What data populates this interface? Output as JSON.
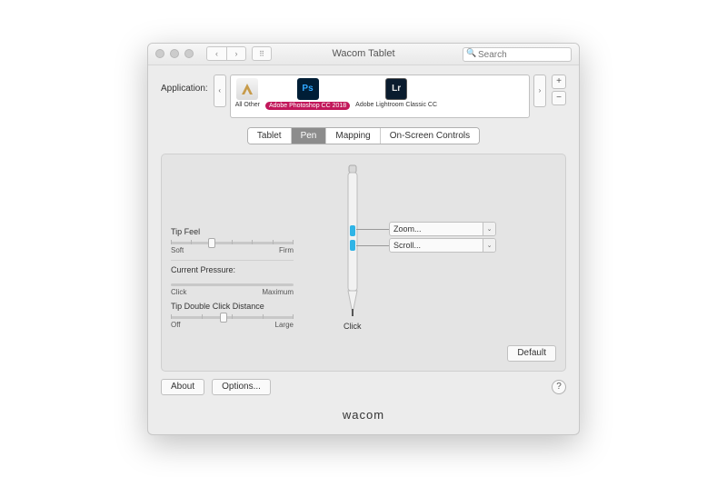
{
  "window": {
    "title": "Wacom Tablet"
  },
  "search": {
    "placeholder": "Search"
  },
  "application": {
    "label": "Application:",
    "items": [
      {
        "label": "All Other"
      },
      {
        "label": "Adobe Photoshop CC 2018"
      },
      {
        "label": "Adobe Lightroom Classic CC"
      }
    ]
  },
  "tabs": {
    "t0": "Tablet",
    "t1": "Pen",
    "t2": "Mapping",
    "t3": "On-Screen Controls"
  },
  "pen": {
    "tipFeel": {
      "label": "Tip Feel",
      "min": "Soft",
      "max": "Firm",
      "value": 30
    },
    "pressure": {
      "label": "Current Pressure:",
      "min": "Click",
      "max": "Maximum"
    },
    "dblClick": {
      "label": "Tip Double Click Distance",
      "min": "Off",
      "max": "Large",
      "value": 40
    },
    "buttonUpper": "Zoom...",
    "buttonLower": "Scroll...",
    "tipAction": "Click",
    "defaultBtn": "Default"
  },
  "footer": {
    "about": "About",
    "options": "Options...",
    "brand": "wacom"
  }
}
